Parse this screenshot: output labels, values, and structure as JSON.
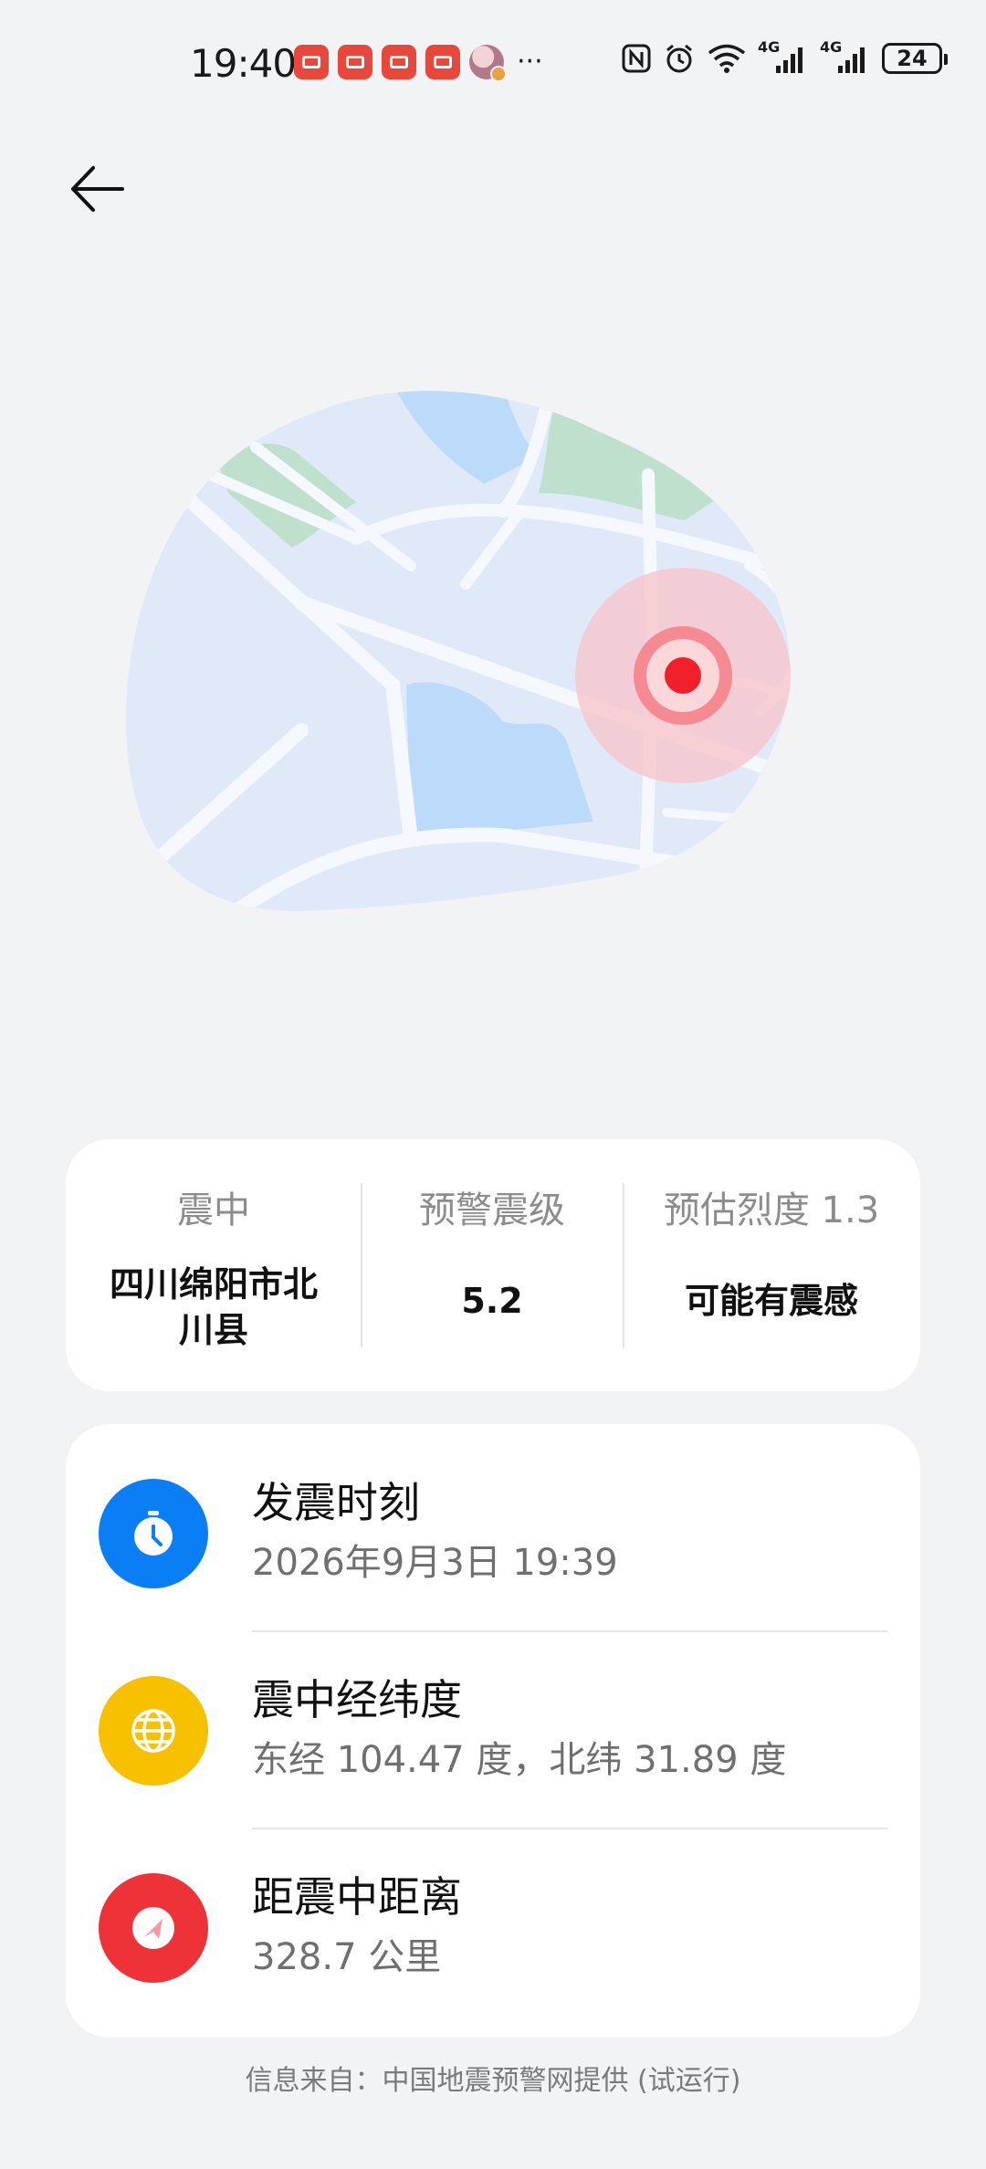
{
  "status_bar": {
    "time": "19:40",
    "network_1": "4G",
    "network_2": "4G",
    "battery": "24",
    "more": "···",
    "icons": [
      "nfc-icon",
      "alarm-icon",
      "wifi-icon",
      "signal-icon",
      "signal-icon",
      "battery-icon"
    ]
  },
  "summary": {
    "epicenter_label": "震中",
    "epicenter_value_line1": "四川绵阳市北",
    "epicenter_value_line2": "川县",
    "magnitude_label": "预警震级",
    "magnitude_value": "5.2",
    "intensity_label": "预估烈度 1.3",
    "intensity_value": "可能有震感"
  },
  "details": {
    "time_title": "发震时刻",
    "time_value": "2026年9月3日 19:39",
    "coords_title": "震中经纬度",
    "coords_value": "东经 104.47 度，北纬 31.89 度",
    "distance_title": "距震中距离",
    "distance_value": "328.7 公里"
  },
  "source_note": "信息来自：中国地震预警网提供 (试运行)",
  "colors": {
    "background": "#f1f3f5",
    "clock_icon_bg": "#0a7ff5",
    "globe_icon_bg": "#f7c100",
    "distance_icon_bg": "#ee3338",
    "epicenter_marker": "#f0202a"
  }
}
